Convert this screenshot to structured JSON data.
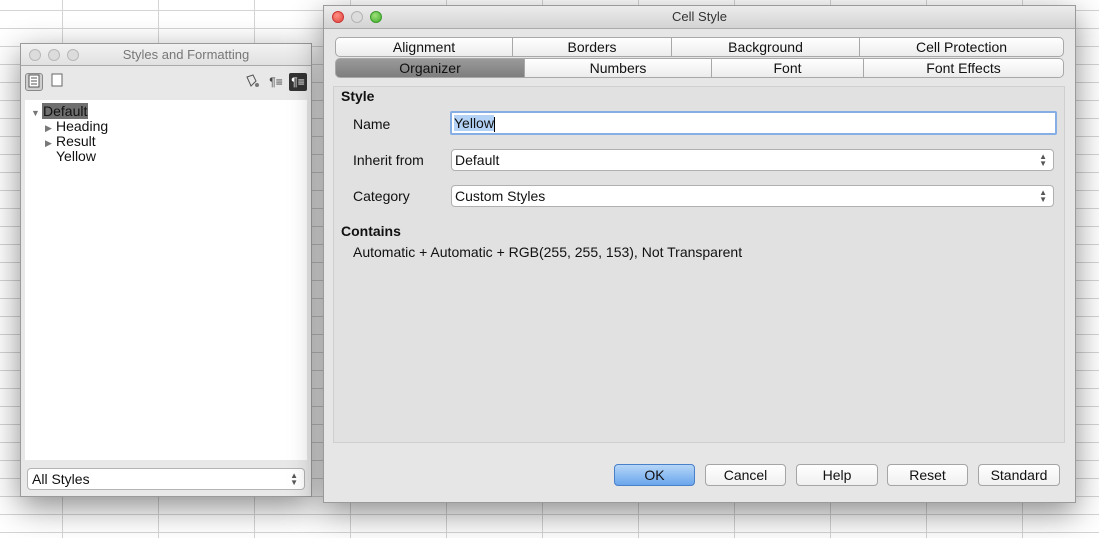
{
  "styles_panel": {
    "title": "Styles and Formatting",
    "tree": [
      {
        "label": "Default",
        "expanded": true,
        "selected": true
      },
      {
        "label": "Heading",
        "expandable": true
      },
      {
        "label": "Result",
        "expandable": true
      },
      {
        "label": "Yellow",
        "expandable": false
      }
    ],
    "filter_value": "All Styles",
    "toolbar_icons": [
      "cell-styles-icon",
      "page-styles-icon",
      "fill-format-icon",
      "new-style-icon",
      "update-style-icon"
    ]
  },
  "dialog": {
    "title": "Cell Style",
    "tabs_row1": [
      "Alignment",
      "Borders",
      "Background",
      "Cell Protection"
    ],
    "tabs_row2": [
      "Organizer",
      "Numbers",
      "Font",
      "Font Effects"
    ],
    "active_tab": "Organizer",
    "style_section": "Style",
    "name_label": "Name",
    "name_value": "Yellow",
    "inherit_label": "Inherit from",
    "inherit_value": "Default",
    "category_label": "Category",
    "category_value": "Custom Styles",
    "contains_section": "Contains",
    "contains_text": "Automatic + Automatic + RGB(255, 255, 153), Not Transparent",
    "buttons": {
      "ok": "OK",
      "cancel": "Cancel",
      "help": "Help",
      "reset": "Reset",
      "standard": "Standard"
    },
    "colors": {
      "default_button": "#6aa6ec",
      "selection": "#b3d2f5",
      "active_tab": "#8a8a8a"
    }
  }
}
